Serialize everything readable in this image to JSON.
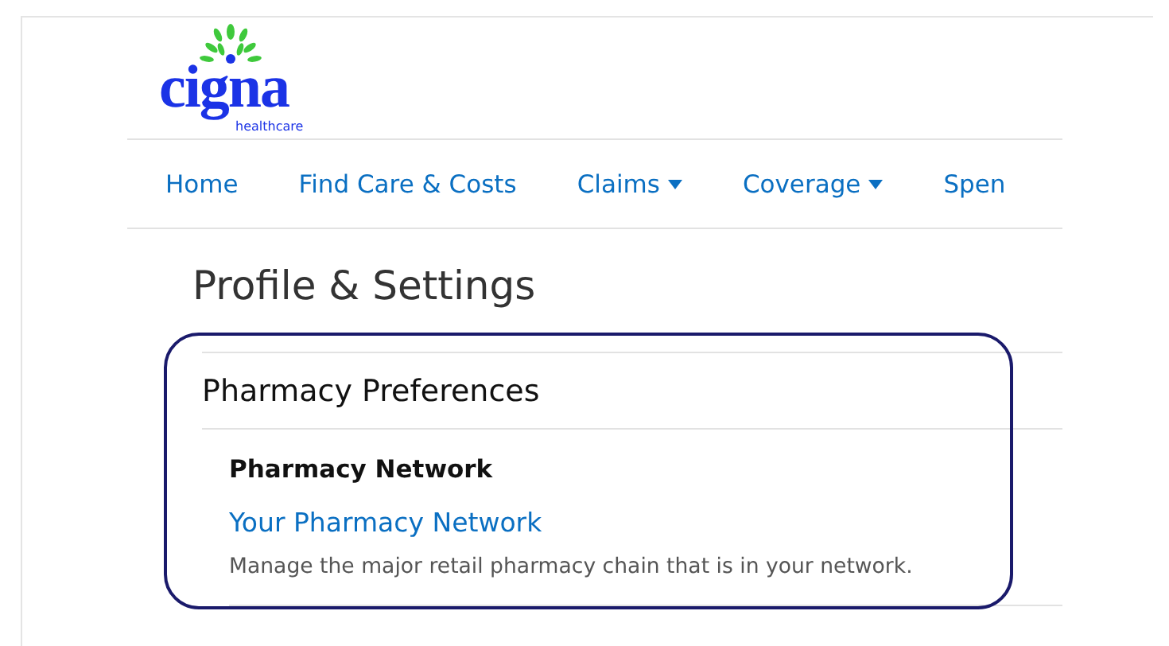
{
  "logo": {
    "wordmark": "cigna",
    "tagline": "healthcare"
  },
  "nav": [
    {
      "label": "Home",
      "has_menu": false
    },
    {
      "label": "Find Care & Costs",
      "has_menu": false
    },
    {
      "label": "Claims",
      "has_menu": true
    },
    {
      "label": "Coverage",
      "has_menu": true
    },
    {
      "label": "Spen",
      "has_menu": false
    }
  ],
  "page_title": "Profile & Settings",
  "section": {
    "title": "Pharmacy Preferences",
    "highlighted": true,
    "items": [
      {
        "heading": "Pharmacy Network",
        "link": "Your Pharmacy Network",
        "description": "Manage the major retail pharmacy chain that is in your network."
      }
    ]
  }
}
